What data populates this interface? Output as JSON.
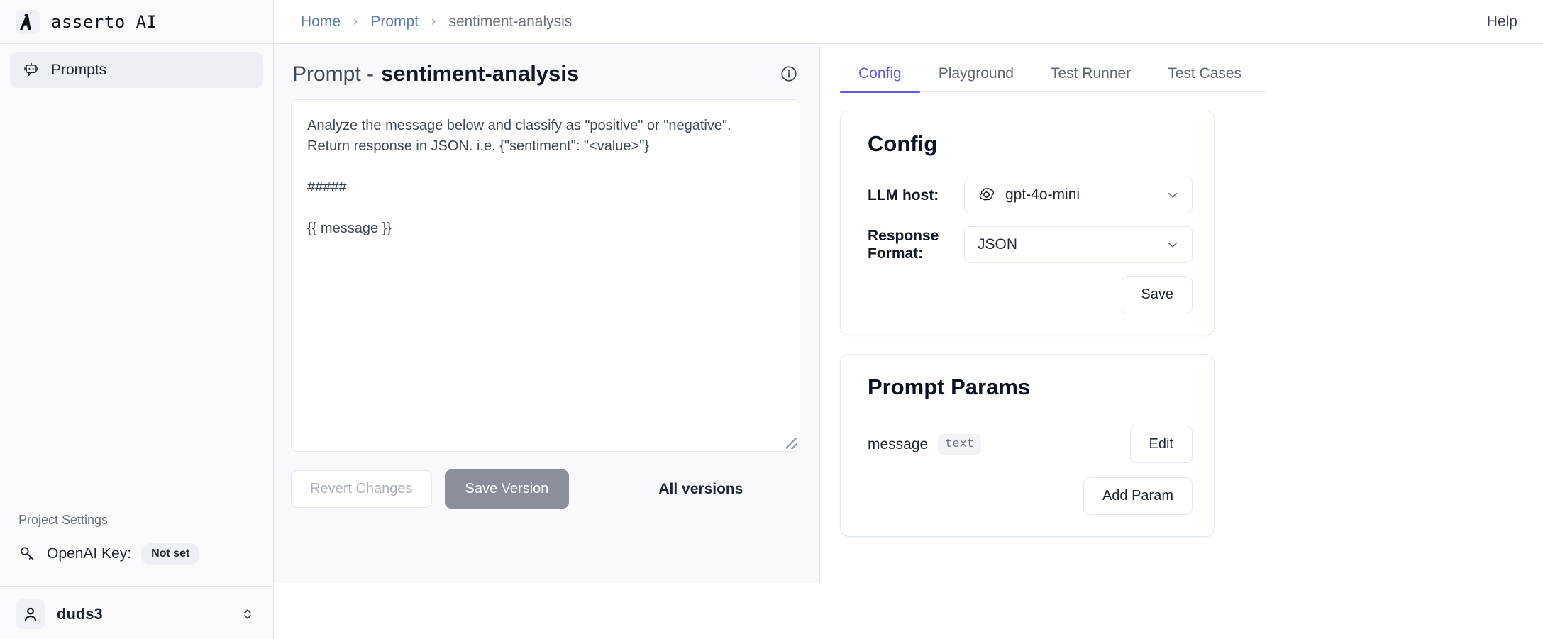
{
  "brand": {
    "logo_icon": "asserto-a-logo-icon",
    "name": "asserto AI"
  },
  "sidebar": {
    "nav": [
      {
        "icon": "chat-bot-icon",
        "label": "Prompts"
      }
    ],
    "project_settings_label": "Project Settings",
    "openai": {
      "icon": "key-icon",
      "label": "OpenAI Key:",
      "status": "Not set"
    },
    "user": {
      "icon": "user-avatar-icon",
      "name": "duds3",
      "switch_icon": "chevron-up-down-icon"
    }
  },
  "topbar": {
    "breadcrumbs": [
      {
        "label": "Home",
        "type": "link"
      },
      {
        "label": "Prompt",
        "type": "link"
      },
      {
        "label": "sentiment-analysis",
        "type": "current"
      }
    ],
    "separator": "›",
    "help_label": "Help"
  },
  "main": {
    "title_prefix": "Prompt -",
    "title_name": "sentiment-analysis",
    "info_icon": "info-circle-icon",
    "prompt_text": "Analyze the message below and classify as \"positive\" or \"negative\".\nReturn response in JSON. i.e. {\"sentiment\": \"<value>\"}\n\n#####\n\n{{ message }}",
    "revert_label": "Revert Changes",
    "save_version_label": "Save Version",
    "all_versions_label": "All versions"
  },
  "tabs": [
    {
      "label": "Config",
      "active": true
    },
    {
      "label": "Playground",
      "active": false
    },
    {
      "label": "Test Runner",
      "active": false
    },
    {
      "label": "Test Cases",
      "active": false
    }
  ],
  "config_card": {
    "title": "Config",
    "llm_host": {
      "label": "LLM host:",
      "icon": "openai-logo-icon",
      "value": "gpt-4o-mini",
      "chevron": "chevron-down-icon"
    },
    "response_format": {
      "label": "Response Format:",
      "value": "JSON",
      "chevron": "chevron-down-icon"
    },
    "save_label": "Save"
  },
  "params_card": {
    "title": "Prompt Params",
    "params": [
      {
        "name": "message",
        "type": "text",
        "edit_label": "Edit"
      }
    ],
    "add_param_label": "Add Param"
  },
  "colors": {
    "accent": "#5b5bf0",
    "link": "#5a7bb5",
    "panel_bg": "#f7f9fc",
    "sidebar_bg": "#f8fafc",
    "primary_button": "#8a8f9a",
    "border": "#e3e9f1"
  }
}
